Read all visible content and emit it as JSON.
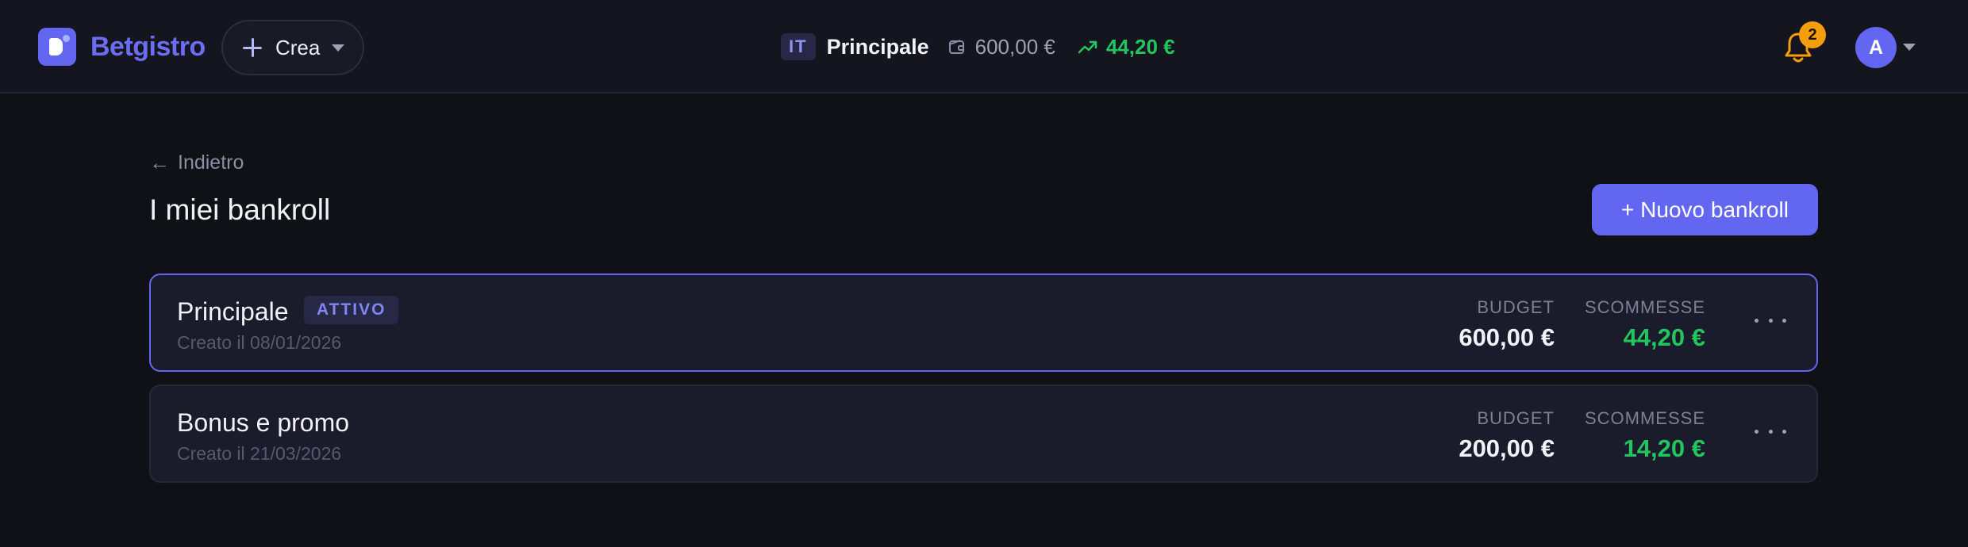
{
  "app": {
    "name": "Betgistro",
    "create_label": "Crea"
  },
  "header": {
    "flag_code": "IT",
    "bankroll_name": "Principale",
    "budget": "600,00 €",
    "profit": "44,20 €",
    "notification_count": "2",
    "avatar_initial": "A",
    "icons": [
      "logo",
      "plus-icon",
      "chevron-down-icon",
      "wallet-icon",
      "trending-up-icon",
      "bell-icon"
    ]
  },
  "page": {
    "back_label": "Indietro",
    "title": "I miei bankroll",
    "new_button_label": "+ Nuovo bankroll"
  },
  "bankrolls": [
    {
      "name": "Principale",
      "status": "ATTIVO",
      "created": "Creato il 08/01/2026",
      "budget_label": "BUDGET",
      "budget": "600,00 €",
      "bets_label": "SCOMMESSE",
      "bets": "44,20 €",
      "active": true
    },
    {
      "name": "Bonus e promo",
      "created": "Creato il 21/03/2026",
      "budget_label": "BUDGET",
      "budget": "200,00 €",
      "bets_label": "SCOMMESSE",
      "bets": "14,20 €",
      "active": false
    }
  ],
  "colors": {
    "accent": "#6366f1",
    "positive": "#22c55e",
    "warning": "#f59e0b",
    "background": "#101116"
  }
}
